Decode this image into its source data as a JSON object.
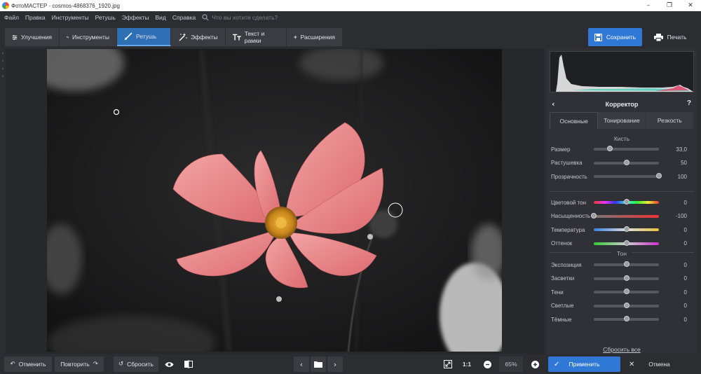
{
  "window": {
    "title": "ФотоМАСТЕР - cosmos-4868376_1920.jpg",
    "minimize": "–",
    "maximize": "❐",
    "close": "✕"
  },
  "menu": {
    "items": [
      "Файл",
      "Правка",
      "Инструменты",
      "Ретушь",
      "Эффекты",
      "Вид",
      "Справка"
    ],
    "search_placeholder": "Что вы хотите сделать?"
  },
  "tabs": [
    {
      "label": "Улучшения",
      "icon": "sliders-icon"
    },
    {
      "label": "Инструменты",
      "icon": "crop-icon"
    },
    {
      "label": "Ретушь",
      "icon": "brush-icon",
      "active": true
    },
    {
      "label": "Эффекты",
      "icon": "magic-wand-icon"
    },
    {
      "label": "Текст и рамки",
      "icon": "text-icon"
    },
    {
      "label": "Расширения",
      "icon": "plus-icon"
    }
  ],
  "actions": {
    "save_label": "Сохранить",
    "print_label": "Печать"
  },
  "panel": {
    "title": "Корректор",
    "help": "?",
    "subtabs": [
      "Основные",
      "Тонирование",
      "Резкость"
    ],
    "active_subtab": "Основные",
    "brush_section": "Кисть",
    "tone_section": "Тон",
    "reset_all": "Сбросить все",
    "brush_sliders": [
      {
        "label": "Размер",
        "value": "33,0",
        "level": 0.25
      },
      {
        "label": "Растушевка",
        "value": "50",
        "level": 0.5
      },
      {
        "label": "Прозрачность",
        "value": "100",
        "level": 1.0
      }
    ],
    "color_sliders": [
      {
        "label": "Цветовой тон",
        "value": "0",
        "level": 0.5,
        "gradient": "hue"
      },
      {
        "label": "Насыщенность",
        "value": "-100",
        "level": 0.0,
        "gradient": "saturation"
      },
      {
        "label": "Температура",
        "value": "0",
        "level": 0.5,
        "gradient": "temperature"
      },
      {
        "label": "Оттенок",
        "value": "0",
        "level": 0.5,
        "gradient": "tint"
      }
    ],
    "tone_sliders": [
      {
        "label": "Экспозиция",
        "value": "0",
        "level": 0.5
      },
      {
        "label": "Засветки",
        "value": "0",
        "level": 0.5
      },
      {
        "label": "Тени",
        "value": "0",
        "level": 0.5
      },
      {
        "label": "Светлые",
        "value": "0",
        "level": 0.5
      },
      {
        "label": "Тёмные",
        "value": "0",
        "level": 0.5
      }
    ]
  },
  "bottom": {
    "undo_label": "Отменить",
    "redo_label": "Повторить",
    "reset_label": "Сбросить",
    "ratio_label": "1:1",
    "zoom_value": "65%",
    "apply_label": "Применить",
    "cancel_label": "Отмена"
  },
  "colors": {
    "accent": "#2f78d6",
    "active_tab": "#2f6fb6",
    "petal": "#e77c7f",
    "flower_center": "#d9961e"
  }
}
